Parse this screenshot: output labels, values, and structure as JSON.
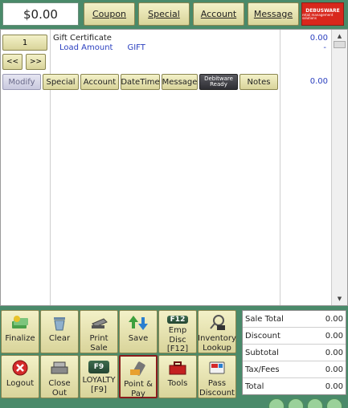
{
  "header": {
    "total": "$0.00",
    "buttons": [
      "Coupon",
      "Special",
      "Account",
      "Message"
    ],
    "logo_line1": "DEBUSWARE",
    "logo_line2": "retail management solutions"
  },
  "item": {
    "qty": "1",
    "prev": "<<",
    "next": ">>",
    "name": "Gift Certificate",
    "sub_label": "Load Amount",
    "sub_value": "GIFT",
    "price": "0.00",
    "dash": "-",
    "line_total": "0.00"
  },
  "modifiers": {
    "modify": "Modify",
    "special": "Special",
    "account": "Account",
    "datetime": "DateTime",
    "message": "Message",
    "debitware_line1": "Debitware",
    "debitware_line2": "Ready",
    "notes": "Notes"
  },
  "functions": {
    "finalize": "Finalize",
    "clear": "Clear",
    "print_sale": "Print Sale",
    "save": "Save",
    "emp_disc_key": "F12",
    "emp_disc_line1": "Emp Disc",
    "emp_disc_line2": "[F12]",
    "inventory_line1": "Inventory",
    "inventory_line2": "Lookup",
    "logout": "Logout",
    "close_out": "Close Out",
    "loyalty_key": "F9",
    "loyalty_line1": "LOYALTY",
    "loyalty_line2": "[F9]",
    "point_pay": "Point & Pay",
    "tools": "Tools",
    "pass_discount_line1": "Pass",
    "pass_discount_line2": "Discount"
  },
  "summary": {
    "rows": [
      {
        "label": "Sale Total",
        "value": "0.00"
      },
      {
        "label": "Discount",
        "value": "0.00"
      },
      {
        "label": "Subtotal",
        "value": "0.00"
      },
      {
        "label": "Tax/Fees",
        "value": "0.00"
      },
      {
        "label": "Total",
        "value": "0.00"
      }
    ]
  }
}
